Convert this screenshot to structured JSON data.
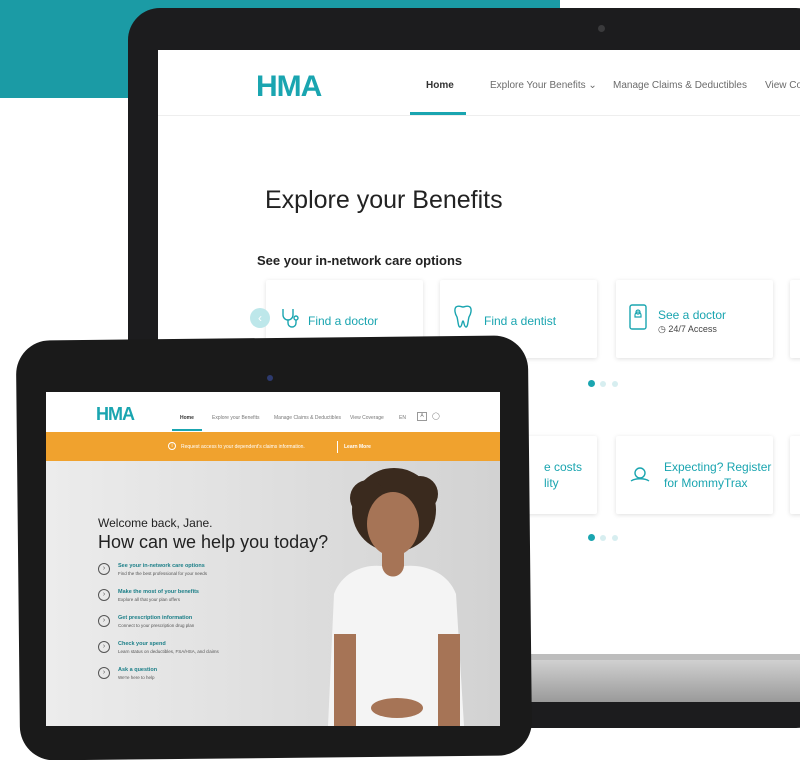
{
  "colors": {
    "teal": "#1aa5b0",
    "orange": "#f0a22e",
    "dark": "#1c1c1e"
  },
  "laptop": {
    "brand": "HMA",
    "nav": [
      "Home",
      "Explore Your Benefits",
      "Manage Claims & Deductibles",
      "View Co"
    ],
    "title": "Explore your Benefits",
    "subtitle": "See your in-network care options",
    "cards": [
      {
        "label": "Find a doctor",
        "icon": "stethoscope-icon"
      },
      {
        "label": "Find a dentist",
        "icon": "tooth-icon"
      },
      {
        "label": "See a doctor",
        "sub": "24/7 Access",
        "icon": "phone-doctor-icon"
      }
    ],
    "cards2": [
      {
        "label_a": "e costs",
        "label_b": "lity"
      },
      {
        "label_a": "Expecting? Register",
        "label_b": "for MommyTrax",
        "icon": "baby-icon"
      }
    ]
  },
  "tablet": {
    "brand": "HMA",
    "nav": [
      "Home",
      "Explore your Benefits",
      "Manage Claims & Deductibles",
      "View Coverage",
      "EN"
    ],
    "banner": "Request access to your dependent's claims information.",
    "banner_link": "Learn More",
    "welcome": "Welcome back, Jane.",
    "headline": "How can we help you today?",
    "options": [
      {
        "title": "See your in-network care options",
        "desc": "Find the the best professional for your needs"
      },
      {
        "title": "Make the most of your benefits",
        "desc": "Explore all that your plan offers"
      },
      {
        "title": "Get prescription information",
        "desc": "Connect to your prescription drug plan"
      },
      {
        "title": "Check your spend",
        "desc": "Learn status on deductibles, FSA/HSA, and claims"
      },
      {
        "title": "Ask a question",
        "desc": "We're here to help"
      }
    ]
  }
}
